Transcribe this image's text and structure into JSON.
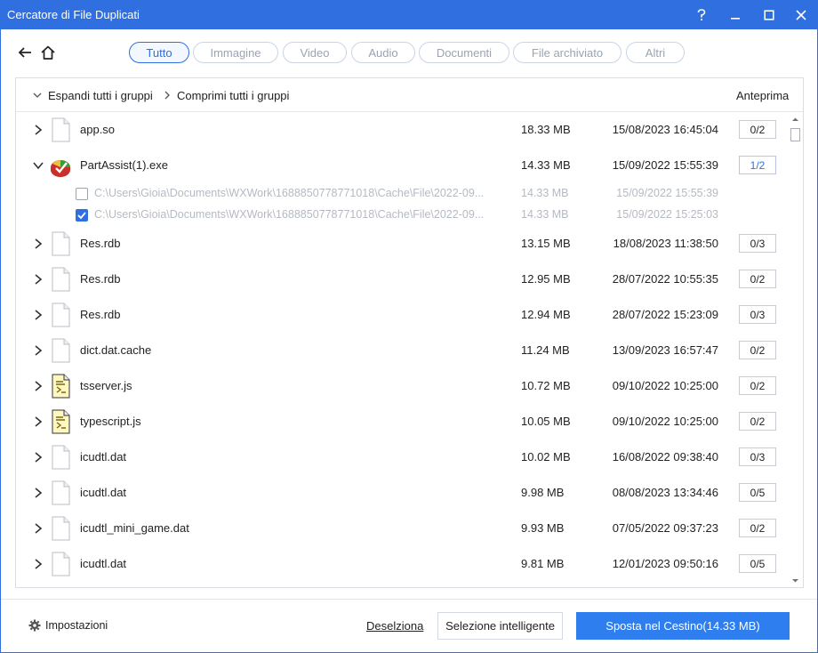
{
  "window": {
    "title": "Cercatore di File Duplicati"
  },
  "tabs": [
    "Tutto",
    "Immagine",
    "Video",
    "Audio",
    "Documenti",
    "File archiviato",
    "Altri"
  ],
  "list_header": {
    "expand_all": "Espandi tutti i gruppi",
    "collapse_all": "Comprimi tutti i gruppi",
    "preview": "Anteprima"
  },
  "groups": [
    {
      "name": "app.so",
      "size": "18.33 MB",
      "date": "15/08/2023 16:45:04",
      "count": "0/2",
      "icon": "file-icon"
    },
    {
      "name": "PartAssist(1).exe",
      "size": "14.33 MB",
      "date": "15/09/2022 15:55:39",
      "count": "1/2",
      "icon": "partassist-app-icon",
      "expanded": true,
      "files": [
        {
          "path": "C:\\Users\\Gioia\\Documents\\WXWork\\1688850778771018\\Cache\\File\\2022-09...",
          "size": "14.33 MB",
          "date": "15/09/2022 15:55:39",
          "checked": false
        },
        {
          "path": "C:\\Users\\Gioia\\Documents\\WXWork\\1688850778771018\\Cache\\File\\2022-09...",
          "size": "14.33 MB",
          "date": "15/09/2022 15:25:03",
          "checked": true
        }
      ]
    },
    {
      "name": "Res.rdb",
      "size": "13.15 MB",
      "date": "18/08/2023 11:38:50",
      "count": "0/3",
      "icon": "file-icon"
    },
    {
      "name": "Res.rdb",
      "size": "12.95 MB",
      "date": "28/07/2022 10:55:35",
      "count": "0/2",
      "icon": "file-icon"
    },
    {
      "name": "Res.rdb",
      "size": "12.94 MB",
      "date": "28/07/2022 15:23:09",
      "count": "0/3",
      "icon": "file-icon"
    },
    {
      "name": "dict.dat.cache",
      "size": "11.24 MB",
      "date": "13/09/2023 16:57:47",
      "count": "0/2",
      "icon": "file-icon"
    },
    {
      "name": "tsserver.js",
      "size": "10.72 MB",
      "date": "09/10/2022 10:25:00",
      "count": "0/2",
      "icon": "script-file-icon"
    },
    {
      "name": "typescript.js",
      "size": "10.05 MB",
      "date": "09/10/2022 10:25:00",
      "count": "0/2",
      "icon": "script-file-icon"
    },
    {
      "name": "icudtl.dat",
      "size": "10.02 MB",
      "date": "16/08/2022 09:38:40",
      "count": "0/3",
      "icon": "file-icon"
    },
    {
      "name": "icudtl.dat",
      "size": "9.98 MB",
      "date": "08/08/2023 13:34:46",
      "count": "0/5",
      "icon": "file-icon"
    },
    {
      "name": "icudtl_mini_game.dat",
      "size": "9.93 MB",
      "date": "07/05/2022 09:37:23",
      "count": "0/2",
      "icon": "file-icon"
    },
    {
      "name": "icudtl.dat",
      "size": "9.81 MB",
      "date": "12/01/2023 09:50:16",
      "count": "0/5",
      "icon": "file-icon"
    }
  ],
  "footer": {
    "settings": "Impostazioni",
    "deselect": "Deselziona",
    "smart_select": "Selezione intelligente",
    "move_to_trash": "Sposta nel Cestino(14.33 MB)"
  },
  "colors": {
    "accent": "#2f6fe0",
    "primary_button": "#2f7ef0"
  }
}
